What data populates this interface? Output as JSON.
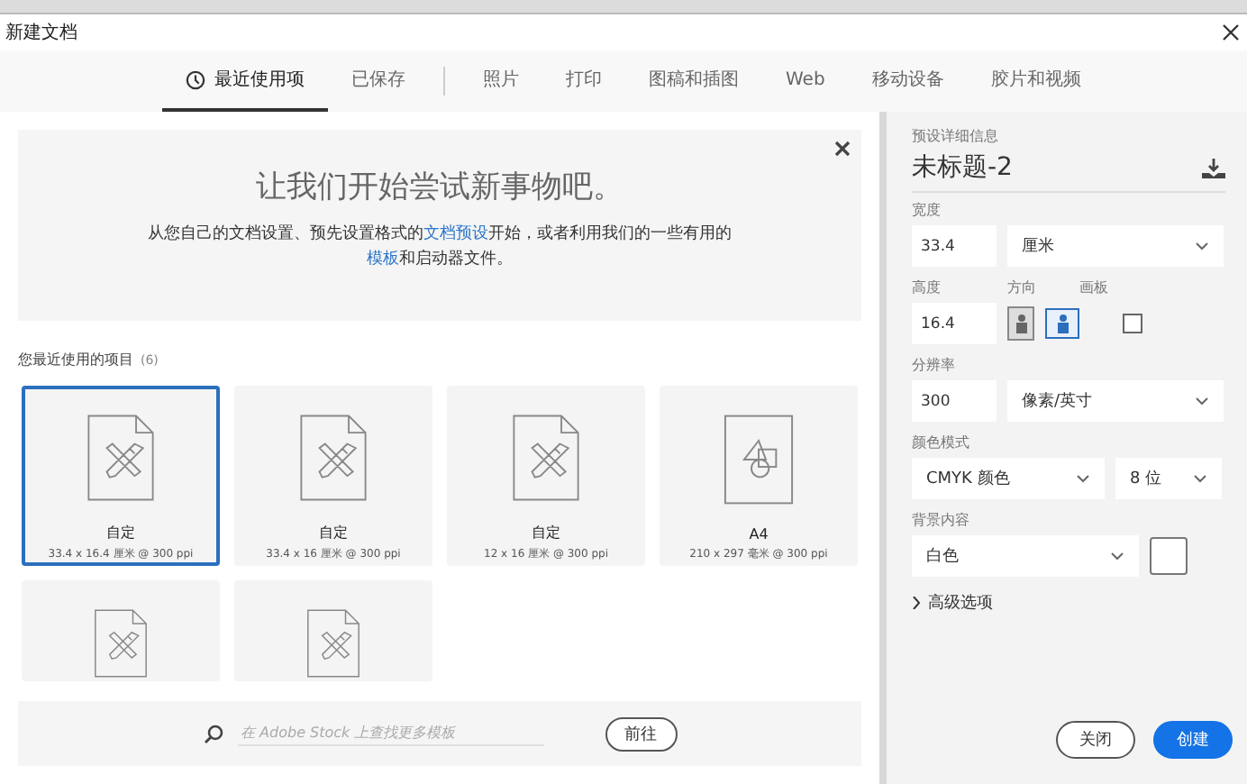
{
  "window": {
    "title": "新建文档"
  },
  "tabs": [
    {
      "label": "最近使用项",
      "selected": true
    },
    {
      "label": "已保存",
      "selected": false,
      "separator_after": true
    },
    {
      "label": "照片",
      "selected": false
    },
    {
      "label": "打印",
      "selected": false
    },
    {
      "label": "图稿和插图",
      "selected": false
    },
    {
      "label": "Web",
      "selected": false
    },
    {
      "label": "移动设备",
      "selected": false
    },
    {
      "label": "胶片和视频",
      "selected": false
    }
  ],
  "welcome": {
    "title": "让我们开始尝试新事物吧。",
    "text": [
      {
        "text": "从您自己的文档设置、预先设置格式的"
      },
      {
        "text": "文档预设",
        "link": true
      },
      {
        "text": "开始，或者利用我们的一些有用的"
      },
      {
        "text": "模板",
        "link": true
      },
      {
        "text": "和启动器文件。"
      }
    ]
  },
  "recent": {
    "heading": "您最近使用的项目",
    "count": "(6)",
    "items": [
      {
        "kind": "custom",
        "name": "自定",
        "size": "33.4 x 16.4 厘米 @ 300 ppi",
        "selected": true
      },
      {
        "kind": "custom",
        "name": "自定",
        "size": "33.4 x 16 厘米 @ 300 ppi",
        "selected": false
      },
      {
        "kind": "custom",
        "name": "自定",
        "size": "12 x 16 厘米 @ 300 ppi",
        "selected": false
      },
      {
        "kind": "shapes",
        "name": "A4",
        "size": "210 x 297 毫米 @ 300 ppi",
        "selected": false
      },
      {
        "kind": "custom",
        "selected": false
      },
      {
        "kind": "custom",
        "selected": false
      }
    ]
  },
  "stock_search": {
    "placeholder": "在 Adobe Stock 上查找更多模板",
    "button": "前往"
  },
  "preset": {
    "heading": "预设详细信息",
    "name": "未标题-2",
    "width": {
      "label": "宽度",
      "value": "33.4",
      "unit": "厘米"
    },
    "height": {
      "label": "高度",
      "value": "16.4"
    },
    "orientation": {
      "label": "方向",
      "options": [
        {
          "kind": "portrait",
          "selected": false
        },
        {
          "kind": "landscape",
          "selected": true
        }
      ]
    },
    "artboards": {
      "label": "画板",
      "checked": false
    },
    "resolution": {
      "label": "分辨率",
      "value": "300",
      "unit": "像素/英寸"
    },
    "color_mode": {
      "label": "颜色模式",
      "value": "CMYK 颜色",
      "depth": "8 位"
    },
    "background": {
      "label": "背景内容",
      "value": "白色",
      "color": "#ffffff"
    },
    "advanced": {
      "label": "高级选项",
      "expanded": false
    },
    "buttons": [
      {
        "label": "关闭",
        "kind": "secondary"
      },
      {
        "label": "创建",
        "kind": "primary"
      }
    ]
  }
}
